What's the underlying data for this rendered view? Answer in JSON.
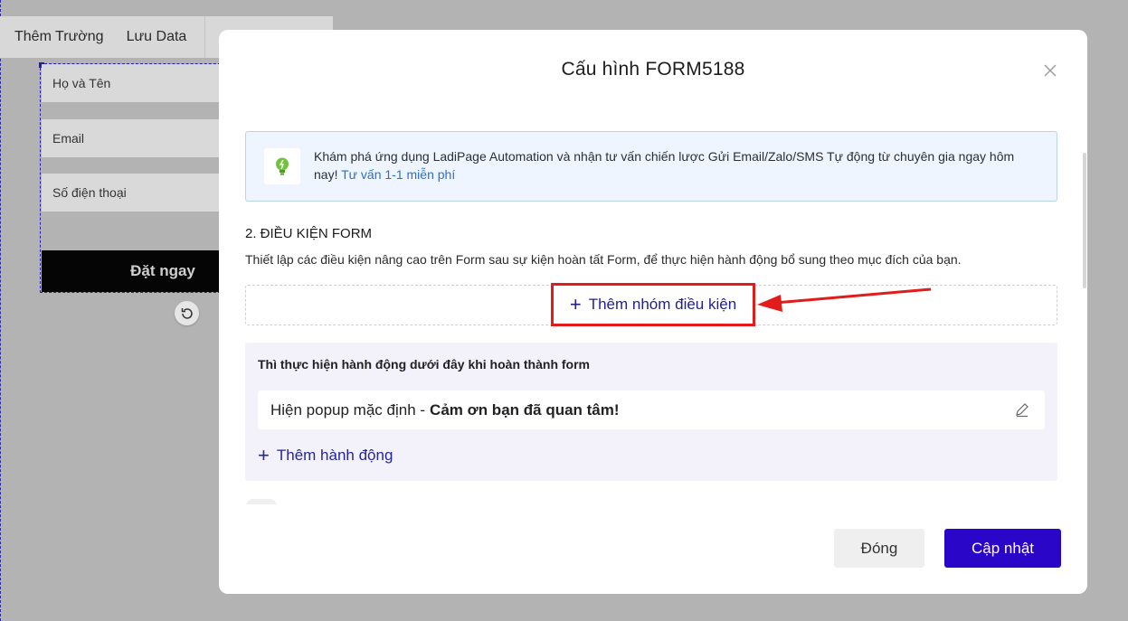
{
  "toolbar": {
    "add_field": "Thêm Trường",
    "save_data": "Lưu Data"
  },
  "form": {
    "fields": [
      "Họ và Tên",
      "Email",
      "Số điện thoại"
    ],
    "submit_label": "Đặt ngay"
  },
  "modal": {
    "title": "Cấu hình FORM5188",
    "info": {
      "text": "Khám phá ứng dụng LadiPage Automation và nhận tư vấn chiến lược Gửi Email/Zalo/SMS Tự động từ chuyên gia ngay hôm nay!",
      "link": "Tư vấn 1-1 miễn phí"
    },
    "section": {
      "title": "2. ĐIỀU KIỆN FORM",
      "description": "Thiết lập các điều kiện nâng cao trên Form sau sự kiện hoàn tất Form, để thực hiện hành động bổ sung theo mục đích của bạn."
    },
    "add_condition_group": "Thêm nhóm điều kiện",
    "actions": {
      "heading": "Thì thực hiện hành động dưới đây khi hoàn thành form",
      "item_prefix": "Hiện popup mặc định -",
      "item_bold": "Cảm ơn bạn đã quan tâm!",
      "add_action": "Thêm hành động"
    },
    "buttons": {
      "close": "Đóng",
      "update": "Cập nhật"
    }
  },
  "colors": {
    "primary": "#2a06c9",
    "highlight": "#e21b1b",
    "link": "#2a6fd6"
  }
}
